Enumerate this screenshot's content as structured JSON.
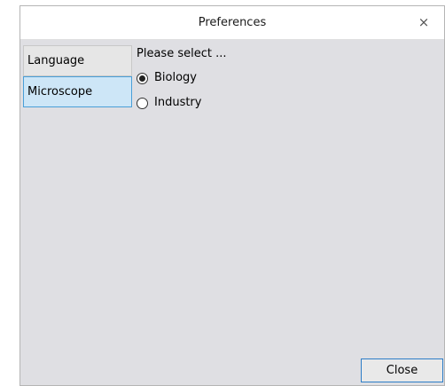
{
  "window": {
    "title": "Preferences",
    "close_glyph": "×"
  },
  "tabs": [
    {
      "label": "Language",
      "selected": false
    },
    {
      "label": "Microscope",
      "selected": true
    }
  ],
  "microscope_panel": {
    "prompt": "Please select ...",
    "options": [
      {
        "label": "Biology",
        "checked": true
      },
      {
        "label": "Industry",
        "checked": false
      }
    ]
  },
  "footer": {
    "close_label": "Close"
  },
  "colors": {
    "window_bg": "#dfdfe3",
    "selected_tab_bg": "#cde6f7",
    "selected_tab_border": "#4a9fd8",
    "button_border": "#2d7dc7"
  }
}
